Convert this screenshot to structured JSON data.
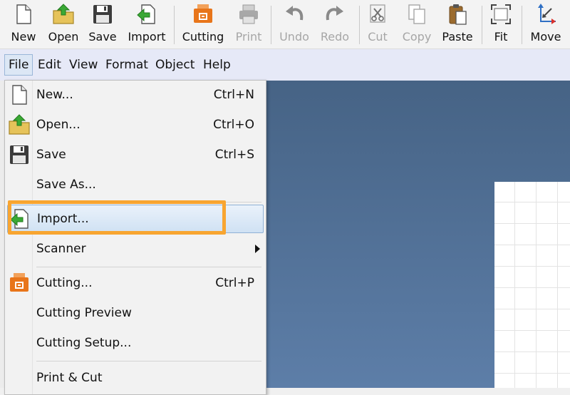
{
  "toolbar": {
    "buttons": [
      {
        "label": "New",
        "icon": "new-document-icon",
        "enabled": true
      },
      {
        "label": "Open",
        "icon": "open-folder-icon",
        "enabled": true
      },
      {
        "label": "Save",
        "icon": "floppy-disk-icon",
        "enabled": true
      },
      {
        "label": "Import",
        "icon": "import-icon",
        "enabled": true
      },
      {
        "label": "Cutting",
        "icon": "cutter-icon",
        "enabled": true
      },
      {
        "label": "Print",
        "icon": "printer-icon",
        "enabled": false
      },
      {
        "label": "Undo",
        "icon": "undo-icon",
        "enabled": false
      },
      {
        "label": "Redo",
        "icon": "redo-icon",
        "enabled": false
      },
      {
        "label": "Cut",
        "icon": "scissors-icon",
        "enabled": false
      },
      {
        "label": "Copy",
        "icon": "copy-icon",
        "enabled": false
      },
      {
        "label": "Paste",
        "icon": "paste-icon",
        "enabled": true
      },
      {
        "label": "Fit",
        "icon": "fit-icon",
        "enabled": true
      },
      {
        "label": "Move",
        "icon": "move-icon",
        "enabled": true
      }
    ]
  },
  "menubar": {
    "items": [
      {
        "label": "File",
        "active": true
      },
      {
        "label": "Edit"
      },
      {
        "label": "View"
      },
      {
        "label": "Format"
      },
      {
        "label": "Object"
      },
      {
        "label": "Help"
      }
    ]
  },
  "file_menu": {
    "items": [
      {
        "label": "New...",
        "shortcut": "Ctrl+N",
        "icon": "new-document-icon"
      },
      {
        "label": "Open...",
        "shortcut": "Ctrl+O",
        "icon": "open-folder-icon"
      },
      {
        "label": "Save",
        "shortcut": "Ctrl+S",
        "icon": "floppy-disk-icon"
      },
      {
        "label": "Save As..."
      },
      {
        "label": "Import...",
        "icon": "import-icon",
        "highlighted": true
      },
      {
        "label": "Scanner",
        "submenu": true
      },
      {
        "label": "Cutting...",
        "shortcut": "Ctrl+P",
        "icon": "cutter-icon"
      },
      {
        "label": "Cutting Preview"
      },
      {
        "label": "Cutting Setup..."
      },
      {
        "label": "Print & Cut"
      }
    ]
  },
  "colors": {
    "accent_orange": "#e8751a",
    "import_green": "#3aa935",
    "highlight_border": "#f8a531",
    "canvas_top": "#466385",
    "canvas_bottom": "#5d7ea8",
    "move_red": "#d9312b",
    "move_blue": "#2f6fc4"
  }
}
